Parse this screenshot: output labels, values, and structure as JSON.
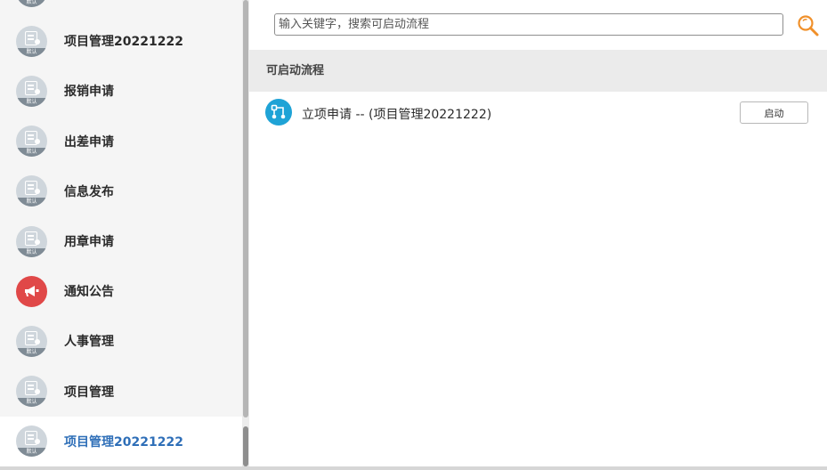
{
  "sidebar": {
    "items": [
      {
        "label": "",
        "icon": "document-app-icon",
        "badge": "默认",
        "active": false
      },
      {
        "label": "项目管理20221222",
        "icon": "document-app-icon",
        "badge": "默认",
        "active": false
      },
      {
        "label": "报销申请",
        "icon": "document-app-icon",
        "badge": "默认",
        "active": false
      },
      {
        "label": "出差申请",
        "icon": "document-app-icon",
        "badge": "默认",
        "active": false
      },
      {
        "label": "信息发布",
        "icon": "document-app-icon",
        "badge": "默认",
        "active": false
      },
      {
        "label": "用章申请",
        "icon": "document-app-icon",
        "badge": "默认",
        "active": false
      },
      {
        "label": "通知公告",
        "icon": "megaphone-icon",
        "badge": "",
        "active": false
      },
      {
        "label": "人事管理",
        "icon": "document-app-icon",
        "badge": "默认",
        "active": false
      },
      {
        "label": "项目管理",
        "icon": "document-app-icon",
        "badge": "默认",
        "active": false
      },
      {
        "label": "项目管理20221222",
        "icon": "document-app-icon",
        "badge": "默认",
        "active": true
      }
    ]
  },
  "search": {
    "placeholder": "输入关键字，搜索可启动流程",
    "value": ""
  },
  "section": {
    "title": "可启动流程"
  },
  "processes": [
    {
      "title": "立项申请 -- (项目管理20221222)",
      "action": "启动",
      "icon": "flow-icon"
    }
  ],
  "colors": {
    "accent": "#2f6fb8",
    "search_icon": "#f0902a",
    "flow_icon": "#1fa3d6",
    "notice_icon": "#e04848"
  }
}
